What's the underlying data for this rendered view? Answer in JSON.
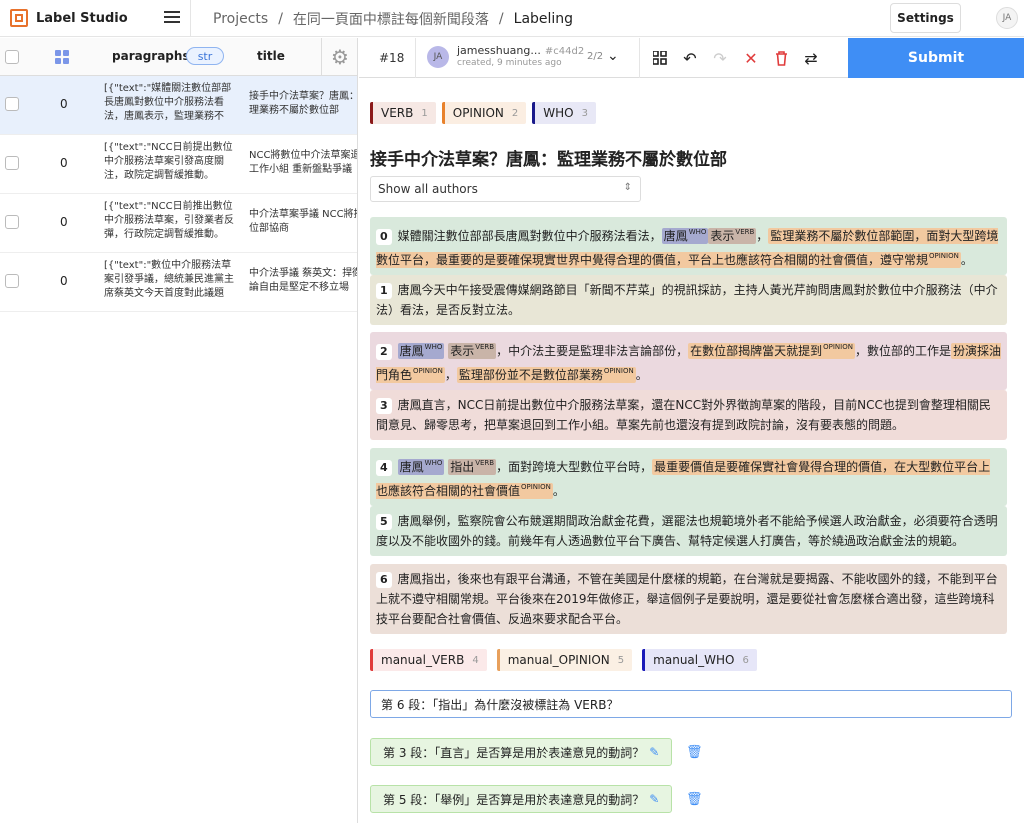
{
  "app": {
    "name": "Label Studio"
  },
  "breadcrumb": {
    "projects": "Projects",
    "sep": "/",
    "project": "在同一頁面中標註每個新聞段落",
    "current": "Labeling"
  },
  "header": {
    "settings": "Settings",
    "user_initials": "JA"
  },
  "table": {
    "columns": {
      "paragraphs": "paragraphs",
      "type_badge": "str",
      "title": "title"
    },
    "rows": [
      {
        "num": "0",
        "paragraphs": "[{\"text\":\"媒體關注數位部部長唐鳳對數位中介服務法看法，唐鳳表示，監理業務不",
        "title1": "接手中介法草案？唐鳳：",
        "title2": "理業務不屬於數位部"
      },
      {
        "num": "0",
        "paragraphs": "[{\"text\":\"NCC日前提出數位中介服務法草案引發高度關注，政院定調暫緩推動。",
        "title1": "NCC將數位中介法草案退",
        "title2": "工作小組 重新盤點爭議"
      },
      {
        "num": "0",
        "paragraphs": "[{\"text\":\"NCC日前推出數位中介服務法草案，引發業者反彈，行政院定調暫緩推動。",
        "title1": "中介法草案爭議 NCC將推",
        "title2": "位部協商"
      },
      {
        "num": "0",
        "paragraphs": "[{\"text\":\"數位中介服務法草案引發爭議，總統兼民進黨主席蔡英文今天首度對此議題",
        "title1": "中介法爭議 蔡英文：捍衛",
        "title2": "論自由是堅定不移立場"
      }
    ]
  },
  "task": {
    "id": "#18",
    "annotator_initials": "JA",
    "annotator": "jamesshuang...",
    "annotation_id": "#c44d2",
    "created": "created, 9 minutes ago",
    "pager": "2/2",
    "submit": "Submit"
  },
  "labels": [
    {
      "name": "VERB",
      "key": "1",
      "color": "#8b1a1a",
      "bg": "#f6e8e4"
    },
    {
      "name": "OPINION",
      "key": "2",
      "color": "#e8822c",
      "bg": "#fbeee2"
    },
    {
      "name": "WHO",
      "key": "3",
      "color": "#1a1a8b",
      "bg": "#e8e8f6"
    }
  ],
  "article_title": "接手中介法草案？唐鳳：監理業務不屬於數位部",
  "authors_select": "Show all authors",
  "paragraphs": [
    {
      "n": "0",
      "bg": "#d9e9dc"
    },
    {
      "n": "1",
      "bg": "#e8e6d6",
      "text": "唐鳳今天中午接受震傳媒網路節目「新聞不芹菜」的視訊採訪，主持人黃光芹詢問唐鳳對於數位中介服務法（中介法）看法，是否反對立法。"
    },
    {
      "n": "2",
      "bg": "#ebd9df"
    },
    {
      "n": "3",
      "bg": "#f0dcd9",
      "text": "唐鳳直言，NCC日前提出數位中介服務法草案，還在NCC對外界徵詢草案的階段，目前NCC也提到會整理相關民間意見、歸零思考，把草案退回到工作小組。草案先前也還沒有提到政院討論，沒有要表態的問題。"
    },
    {
      "n": "4",
      "bg": "#d9e9dc"
    },
    {
      "n": "5",
      "bg": "#d9e9dc",
      "text": "唐鳳舉例，監察院會公布競選期間政治獻金花費，選罷法也規範境外者不能給予候選人政治獻金，必須要符合透明度以及不能收國外的錢。前幾年有人透過數位平台下廣告、幫特定候選人打廣告，等於繞過政治獻金法的規範。"
    },
    {
      "n": "6",
      "bg": "#ecdfd8",
      "text": "唐鳳指出，後來也有跟平台溝通，不管在美國是什麼樣的規範，在台灣就是要揭露、不能收國外的錢，不能到平台上就不遵守相關常規。平台後來在2019年做修正，舉這個例子是要說明，還是要從社會怎麼樣合適出發，這些跨境科技平台要配合社會價值、反過來要求配合平台。"
    }
  ],
  "p0": {
    "a": "媒體關注數位部部長唐鳳對數位中介服務法看法，",
    "who": "唐鳳",
    "verb": "表示",
    "b": "，",
    "op": "監理業務不屬於數位部範圍，面對大型跨境數位平台，最重要的是要確保現實世界中覺得合理的價值，平台上也應該符合相關的社會價值，遵守常規",
    "c": "。"
  },
  "p2": {
    "who": "唐鳳",
    "verb": "表示",
    "a": "，中介法主要是監理非法言論部份，",
    "op1": "在數位部揭牌當天就提到",
    "b": "，數位部的工作是",
    "op2": "扮演採油門角色",
    "c": "，",
    "op3": "監理部份並不是數位部業務",
    "d": "。"
  },
  "p4": {
    "who": "唐鳳",
    "verb": "指出",
    "a": "，面對跨境大型數位平台時，",
    "op": "最重要價值是要確保實社會覺得合理的價值，在大型數位平台上也應該符合相關的社會價值",
    "b": "。"
  },
  "tags": {
    "who": "WHO",
    "verb": "VERB",
    "op": "OPINION"
  },
  "manual_labels": [
    {
      "name": "manual_VERB",
      "key": "4",
      "color": "#e03c3c",
      "bg": "#fbe9e9"
    },
    {
      "name": "manual_OPINION",
      "key": "5",
      "color": "#e8a05c",
      "bg": "#fbf0e4"
    },
    {
      "name": "manual_WHO",
      "key": "6",
      "color": "#1a1ab8",
      "bg": "#e6e6f8"
    }
  ],
  "question_input": "第 6 段：「指出」為什麼沒被標註為 VERB？",
  "questions": [
    "第 3 段：「直言」是否算是用於表達意見的動詞？",
    "第 5 段：「舉例」是否算是用於表達意見的動詞？"
  ]
}
